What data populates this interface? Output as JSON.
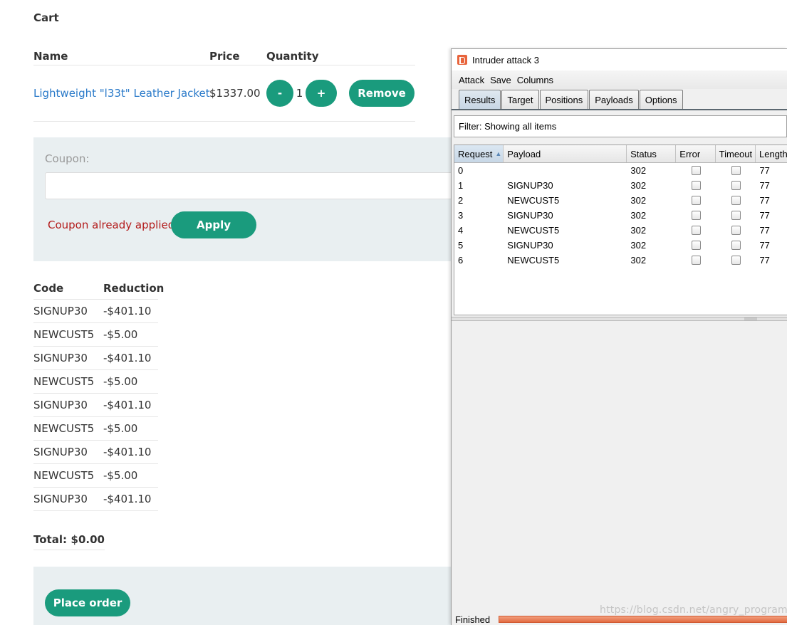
{
  "cart": {
    "title": "Cart",
    "headers": {
      "name": "Name",
      "price": "Price",
      "quantity": "Quantity"
    },
    "item": {
      "name": "Lightweight \"l33t\" Leather Jacket",
      "price": "$1337.00",
      "minus": "-",
      "quantity": "1",
      "plus": "+",
      "remove": "Remove"
    }
  },
  "coupon": {
    "label": "Coupon:",
    "value": "",
    "message": "Coupon already applied",
    "apply": "Apply"
  },
  "codes": {
    "headers": {
      "code": "Code",
      "reduction": "Reduction"
    },
    "rows": [
      {
        "code": "SIGNUP30",
        "reduction": "-$401.10"
      },
      {
        "code": "NEWCUST5",
        "reduction": "-$5.00"
      },
      {
        "code": "SIGNUP30",
        "reduction": "-$401.10"
      },
      {
        "code": "NEWCUST5",
        "reduction": "-$5.00"
      },
      {
        "code": "SIGNUP30",
        "reduction": "-$401.10"
      },
      {
        "code": "NEWCUST5",
        "reduction": "-$5.00"
      },
      {
        "code": "SIGNUP30",
        "reduction": "-$401.10"
      },
      {
        "code": "NEWCUST5",
        "reduction": "-$5.00"
      },
      {
        "code": "SIGNUP30",
        "reduction": "-$401.10"
      }
    ]
  },
  "total": {
    "label": "Total:",
    "value": "$0.00"
  },
  "order": {
    "place": "Place order"
  },
  "intruder": {
    "title": "Intruder attack 3",
    "menu": [
      "Attack",
      "Save",
      "Columns"
    ],
    "tabs": [
      "Results",
      "Target",
      "Positions",
      "Payloads",
      "Options"
    ],
    "active_tab": "Results",
    "filter": "Filter: Showing all items",
    "columns": {
      "request": "Request",
      "payload": "Payload",
      "status": "Status",
      "error": "Error",
      "timeout": "Timeout",
      "length": "Length"
    },
    "sort_indicator": "▲",
    "rows": [
      {
        "request": "0",
        "payload": "",
        "status": "302",
        "error": false,
        "timeout": false,
        "length": "77"
      },
      {
        "request": "1",
        "payload": "SIGNUP30",
        "status": "302",
        "error": false,
        "timeout": false,
        "length": "77"
      },
      {
        "request": "2",
        "payload": "NEWCUST5",
        "status": "302",
        "error": false,
        "timeout": false,
        "length": "77"
      },
      {
        "request": "3",
        "payload": "SIGNUP30",
        "status": "302",
        "error": false,
        "timeout": false,
        "length": "77"
      },
      {
        "request": "4",
        "payload": "NEWCUST5",
        "status": "302",
        "error": false,
        "timeout": false,
        "length": "77"
      },
      {
        "request": "5",
        "payload": "SIGNUP30",
        "status": "302",
        "error": false,
        "timeout": false,
        "length": "77"
      },
      {
        "request": "6",
        "payload": "NEWCUST5",
        "status": "302",
        "error": false,
        "timeout": false,
        "length": "77"
      }
    ],
    "status_text": "Finished",
    "progress": 1.0
  },
  "watermark": "https://blog.csdn.net/angry_program",
  "colors": {
    "accent": "#1a9b7d",
    "link": "#2a7ac9",
    "error_text": "#b31a1a",
    "panel_bg": "#e9eff1",
    "burp_orange": "#e8643c"
  }
}
